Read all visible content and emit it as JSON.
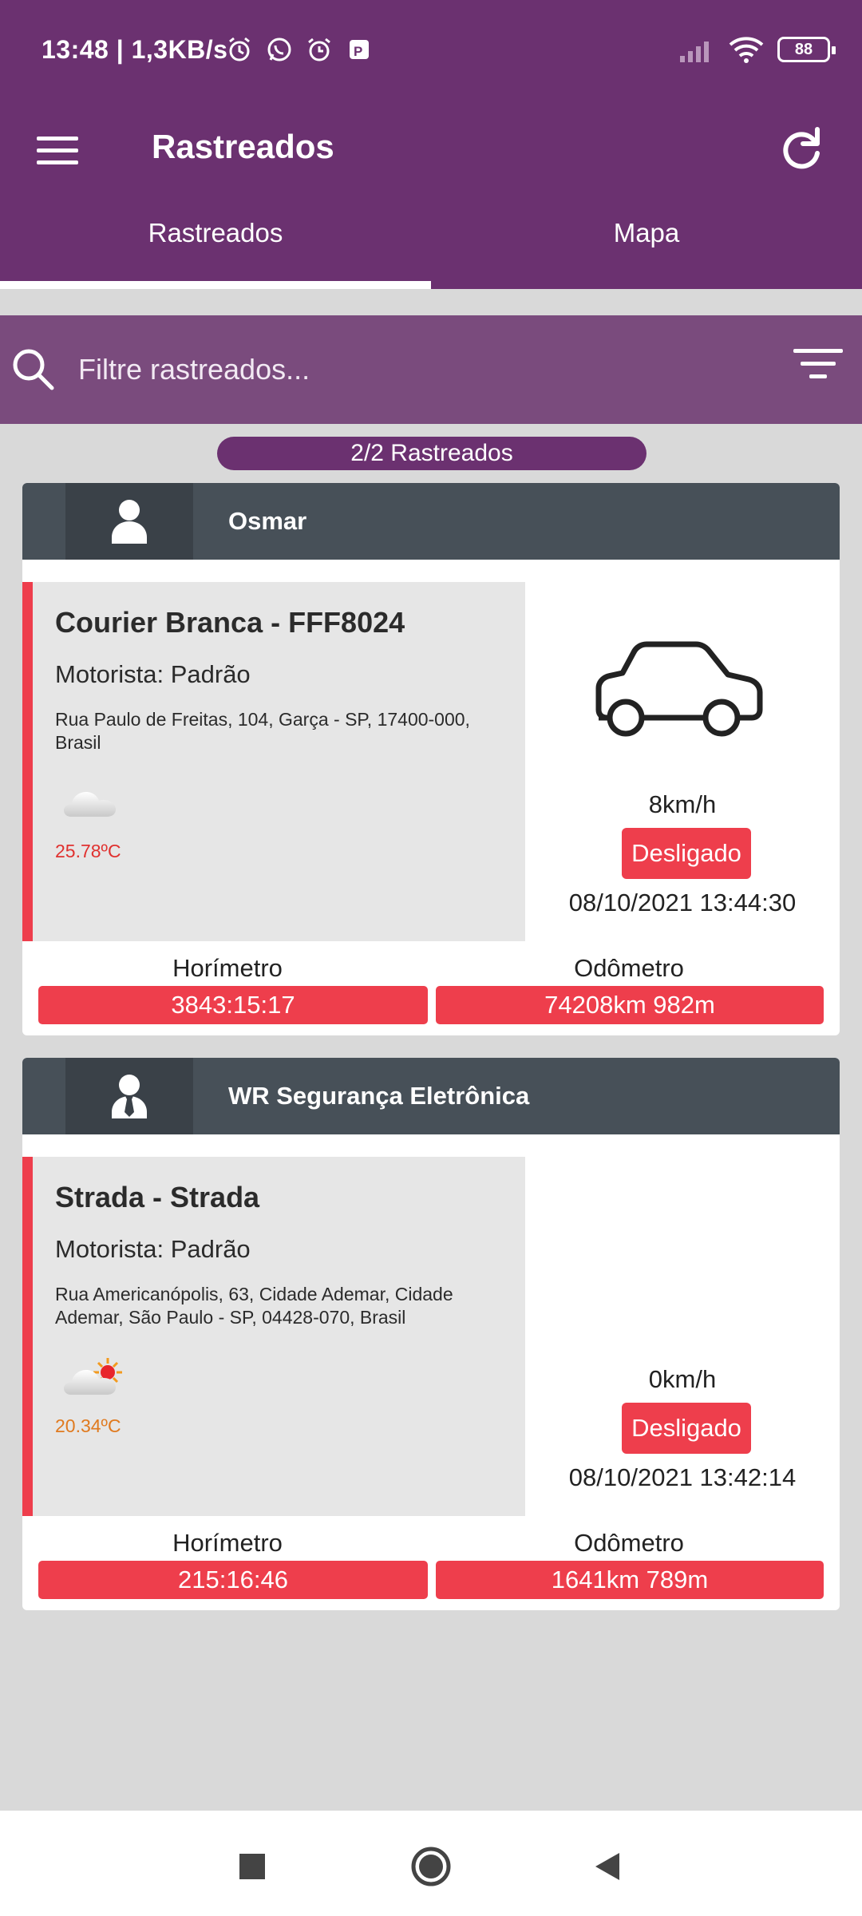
{
  "status_bar": {
    "time_and_speed": "13:48 | 1,3KB/s",
    "left_icons": [
      "alarm-clock-icon",
      "whatsapp-icon",
      "alarm-icon",
      "parking-app-icon"
    ],
    "battery": "88"
  },
  "app_bar": {
    "title": "Rastreados",
    "menu_icon": "hamburger-menu-icon",
    "refresh_icon": "refresh-icon"
  },
  "tabs": [
    {
      "label": "Rastreados",
      "active": true
    },
    {
      "label": "Mapa",
      "active": false
    }
  ],
  "search": {
    "placeholder": "Filtre rastreados...",
    "value": ""
  },
  "count_label": "2/2 Rastreados",
  "cards": [
    {
      "owner": "Osmar",
      "avatar_icon": "person-icon",
      "vehicle": "Courier Branca - FFF8024",
      "driver": "Motorista: Padrão",
      "address": "Rua Paulo de Freitas, 104, Garça - SP, 17400-000, Brasil",
      "weather_icon": "cloud-icon",
      "temperature": "25.78ºC",
      "temperature_color": "#e0312f",
      "vehicle_icon": "car-icon",
      "speed": "8km/h",
      "state": "Desligado",
      "timestamp": "08/10/2021 13:44:30",
      "hourmeter_label": "Horímetro",
      "hourmeter_value": "3843:15:17",
      "odometer_label": "Odômetro",
      "odometer_value": "74208km 982m"
    },
    {
      "owner": "WR Segurança Eletrônica",
      "avatar_icon": "businessman-icon",
      "vehicle": "Strada - Strada",
      "driver": "Motorista: Padrão",
      "address": "Rua Americanópolis, 63, Cidade Ademar, Cidade Ademar, São Paulo - SP, 04428-070, Brasil",
      "weather_icon": "partly-sunny-icon",
      "temperature": "20.34ºC",
      "temperature_color": "#e07a1f",
      "speed": "0km/h",
      "state": "Desligado",
      "timestamp": "08/10/2021 13:42:14",
      "hourmeter_label": "Horímetro",
      "hourmeter_value": "215:16:46",
      "odometer_label": "Odômetro",
      "odometer_value": "1641km 789m"
    }
  ],
  "colors": {
    "primary": "#6b3170",
    "search_bar": "#7a4b7d",
    "card_header": "#475058",
    "accent_red": "#ee3e4c",
    "background": "#d9d9d9"
  },
  "nav_bar": {
    "icons": [
      "recents-square-icon",
      "home-circle-icon",
      "back-triangle-icon"
    ]
  }
}
